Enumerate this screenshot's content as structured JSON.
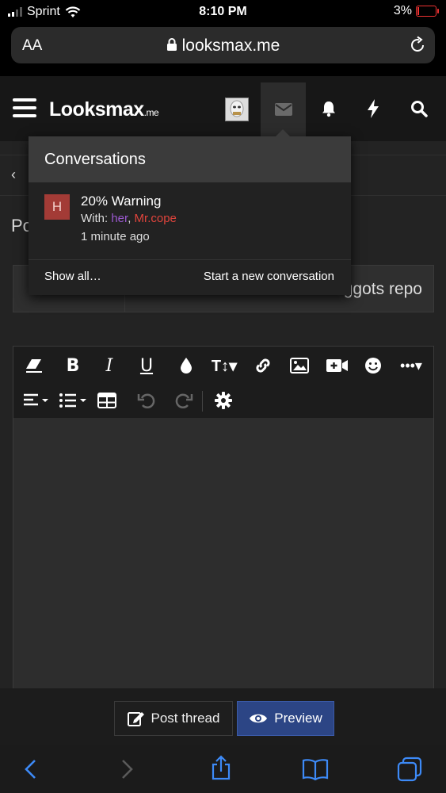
{
  "status_bar": {
    "carrier": "Sprint",
    "time": "8:10 PM",
    "battery": "3%",
    "battery_level": 0.03
  },
  "browser": {
    "text_size_label": "AA",
    "url": "looksmax.me"
  },
  "site": {
    "logo": "Looksmax",
    "logo_suffix": ".me"
  },
  "page": {
    "heading_partial": "Po",
    "title_value": "ggots repo"
  },
  "popup": {
    "title": "Conversations",
    "conversation": {
      "avatar_letter": "H",
      "title": "20% Warning",
      "with_label": "With:",
      "participants": [
        {
          "name": "her",
          "color": "#9b59d0"
        },
        {
          "name": "Mr.cope",
          "color": "#e0443c"
        }
      ],
      "time": "1 minute ago"
    },
    "show_all": "Show all…",
    "start_new": "Start a new conversation"
  },
  "actions": {
    "post_thread": "Post thread",
    "preview": "Preview"
  },
  "colors": {
    "accent": "#2c4585",
    "safari_blue": "#3d8af7"
  }
}
